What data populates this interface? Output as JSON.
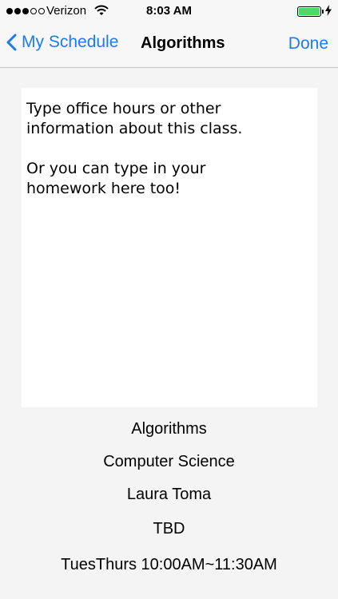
{
  "status_bar": {
    "carrier": "Verizon",
    "time": "8:03 AM",
    "signal_icon": "signal-dots-icon",
    "wifi_icon": "wifi-icon",
    "battery_icon": "battery-icon",
    "charging_icon": "charging-bolt-icon",
    "battery_color": "#4cd964"
  },
  "nav": {
    "back_label": "My Schedule",
    "title": "Algorithms",
    "done_label": "Done",
    "accent_color": "#1a7cf5"
  },
  "notes": {
    "lines": [
      "Type office hours or other",
      "information about this class.",
      "Or you can type in your",
      "homework here too!"
    ]
  },
  "class_info": {
    "name": "Algorithms",
    "department": "Computer Science",
    "instructor": "Laura Toma",
    "location": "TBD",
    "schedule": "TuesThurs 10:00AM~11:30AM"
  }
}
